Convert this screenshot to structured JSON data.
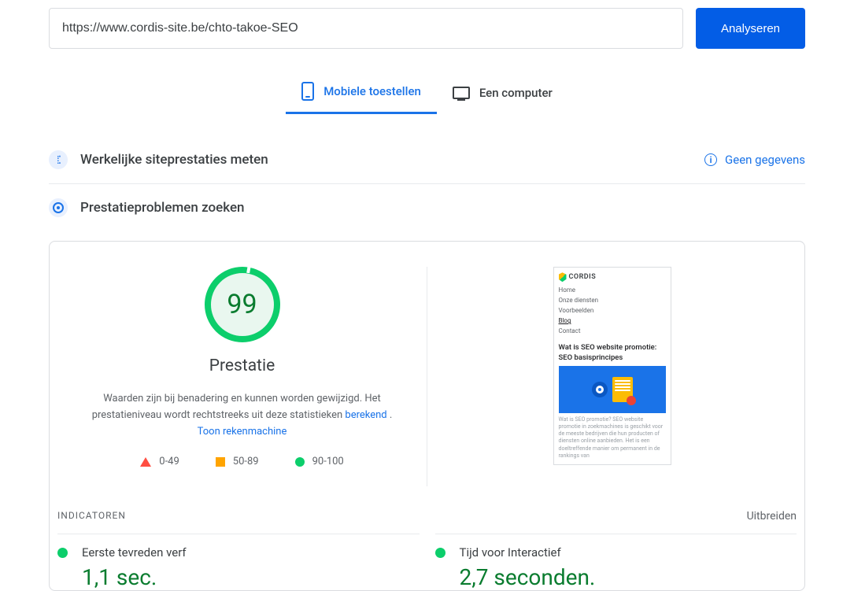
{
  "input": {
    "url": "https://www.cordis-site.be/chto-takoe-SEO",
    "analyze_btn": "Analyseren"
  },
  "tabs": {
    "mobile": "Mobiele toestellen",
    "desktop": "Een computer"
  },
  "field_data": {
    "title": "Werkelijke siteprestaties meten",
    "nodata": "Geen gegevens"
  },
  "lab": {
    "title": "Prestatieproblemen zoeken"
  },
  "score": {
    "value": "99",
    "label": "Prestatie",
    "desc_pre": "Waarden zijn bij benadering en kunnen worden gewijzigd. Het prestatieniveau wordt rechtstreeks uit deze statistieken ",
    "link1": "berekend",
    "sep": " . ",
    "link2": "Toon rekenmachine"
  },
  "legend": {
    "low": "0-49",
    "mid": "50-89",
    "high": "90-100"
  },
  "preview": {
    "brand": "CORDIS",
    "nav": {
      "home": "Home",
      "services": "Onze diensten",
      "examples": "Voorbeelden",
      "blog": "Blog",
      "contact": "Contact"
    },
    "heading": "Wat is SEO website promotie: SEO basisprincipes",
    "body": "Wat is SEO promotie? SEO website promotie in zoekmachines is geschikt voor de meeste bedrijven die hun producten of diensten online aanbieden. Het is een doeltreffende manier om permanent in de rankings van"
  },
  "indicators": {
    "header": "INDICATOREN",
    "expand": "Uitbreiden",
    "items": [
      {
        "name": "Eerste tevreden verf",
        "value": "1,1 sec."
      },
      {
        "name": "Tijd voor Interactief",
        "value": "2,7 seconden."
      }
    ]
  }
}
